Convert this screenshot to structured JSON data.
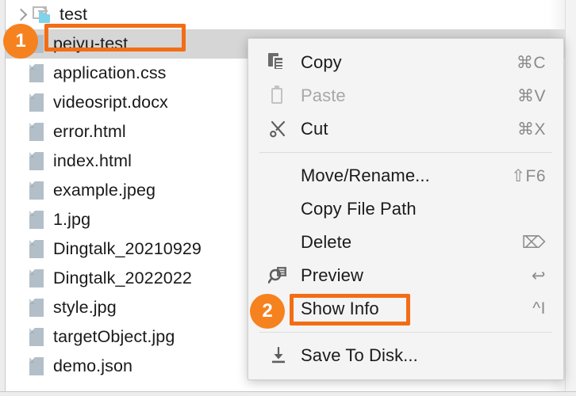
{
  "tree": {
    "rows": [
      {
        "label": "test",
        "icon": "module-folder-icon",
        "type": "module",
        "expander": "chevron-right-icon",
        "selected": false
      },
      {
        "label": "peiyu-test",
        "icon": "file-icon",
        "type": "file",
        "expander": "none",
        "selected": true
      },
      {
        "label": "application.css",
        "icon": "file-icon",
        "type": "file",
        "expander": "none",
        "selected": false
      },
      {
        "label": "videosript.docx",
        "icon": "file-icon",
        "type": "file",
        "expander": "none",
        "selected": false
      },
      {
        "label": "error.html",
        "icon": "file-icon",
        "type": "file",
        "expander": "none",
        "selected": false
      },
      {
        "label": "index.html",
        "icon": "file-icon",
        "type": "file",
        "expander": "none",
        "selected": false
      },
      {
        "label": "example.jpeg",
        "icon": "file-icon",
        "type": "file",
        "expander": "none",
        "selected": false
      },
      {
        "label": "1.jpg",
        "icon": "file-icon",
        "type": "file",
        "expander": "none",
        "selected": false
      },
      {
        "label": "Dingtalk_20210929",
        "icon": "file-icon",
        "type": "file",
        "expander": "none",
        "selected": false
      },
      {
        "label": "Dingtalk_2022022",
        "icon": "file-icon",
        "type": "file",
        "expander": "none",
        "selected": false
      },
      {
        "label": "style.jpg",
        "icon": "file-icon",
        "type": "file",
        "expander": "none",
        "selected": false
      },
      {
        "label": "targetObject.jpg",
        "icon": "file-icon",
        "type": "file",
        "expander": "none",
        "selected": false
      },
      {
        "label": "demo.json",
        "icon": "file-icon",
        "type": "file",
        "expander": "none",
        "selected": false
      }
    ]
  },
  "context_menu": {
    "items": [
      {
        "label": "Copy",
        "shortcut": "⌘C",
        "icon": "copy-icon",
        "disabled": false,
        "highlighted": false
      },
      {
        "label": "Paste",
        "shortcut": "⌘V",
        "icon": "paste-icon",
        "disabled": true,
        "highlighted": false
      },
      {
        "label": "Cut",
        "shortcut": "⌘X",
        "icon": "cut-icon",
        "disabled": false,
        "highlighted": false
      },
      {
        "label": "Move/Rename...",
        "shortcut": "⇧F6",
        "icon": "none",
        "disabled": false,
        "highlighted": false
      },
      {
        "label": "Copy File Path",
        "shortcut": "",
        "icon": "none",
        "disabled": false,
        "highlighted": false
      },
      {
        "label": "Delete",
        "shortcut": "⌦",
        "icon": "none",
        "disabled": false,
        "highlighted": false
      },
      {
        "label": "Preview",
        "shortcut": "↩",
        "icon": "preview-icon",
        "disabled": false,
        "highlighted": false
      },
      {
        "label": "Show Info",
        "shortcut": "^I",
        "icon": "none",
        "disabled": false,
        "highlighted": true
      },
      {
        "label": "Save To Disk...",
        "shortcut": "",
        "icon": "save-to-disk-icon",
        "disabled": false,
        "highlighted": false
      }
    ]
  },
  "annotations": {
    "color": "#f5821f",
    "badges": [
      {
        "number": "1",
        "target": "peiyu-test"
      },
      {
        "number": "2",
        "target": "Show Info"
      }
    ]
  }
}
